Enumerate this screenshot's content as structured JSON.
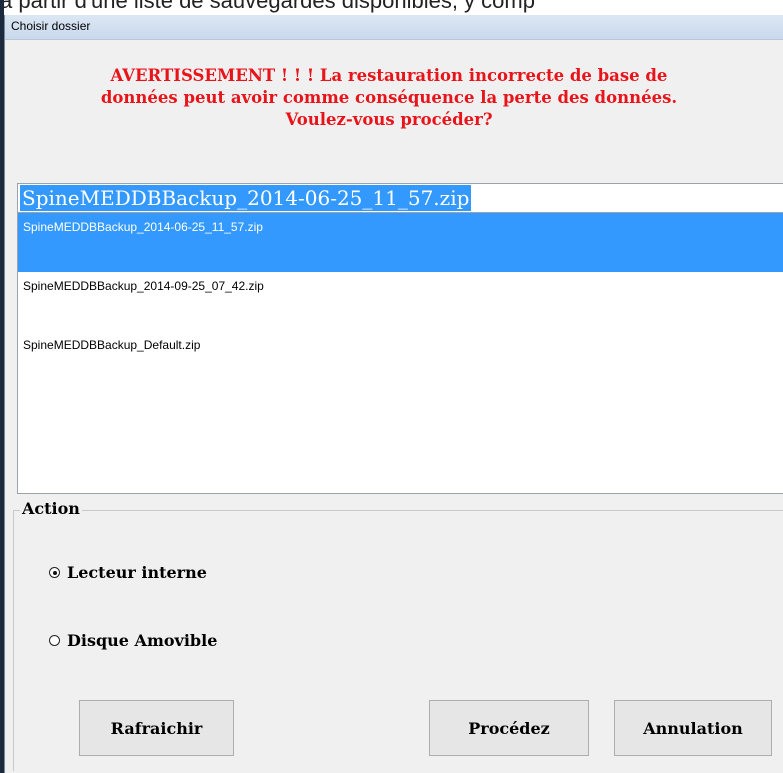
{
  "background": {
    "text": "à partir d'une liste de sauvegardes disponibles, y comp"
  },
  "window": {
    "title": "Choisir dossier"
  },
  "warning": {
    "line1": "AVERTISSEMENT ! ! ! La restauration incorrecte de base de",
    "line2": "données peut avoir comme conséquence la perte des données.",
    "line3": "Voulez-vous procéder?",
    "color": "#e8141a"
  },
  "backup_select": {
    "value": "SpineMEDDBBackup_2014-06-25_11_57.zip",
    "items": [
      "SpineMEDDBBackup_2014-06-25_11_57.zip",
      "SpineMEDDBBackup_2014-09-25_07_42.zip",
      "SpineMEDDBBackup_Default.zip"
    ],
    "selected_index": 0,
    "selection_color": "#3399ff"
  },
  "action": {
    "legend": "Action",
    "options": [
      "Lecteur interne",
      "Disque Amovible"
    ],
    "selected_index": 0
  },
  "buttons": {
    "refresh": "Rafraichir",
    "proceed": "Procédez",
    "cancel": "Annulation"
  }
}
